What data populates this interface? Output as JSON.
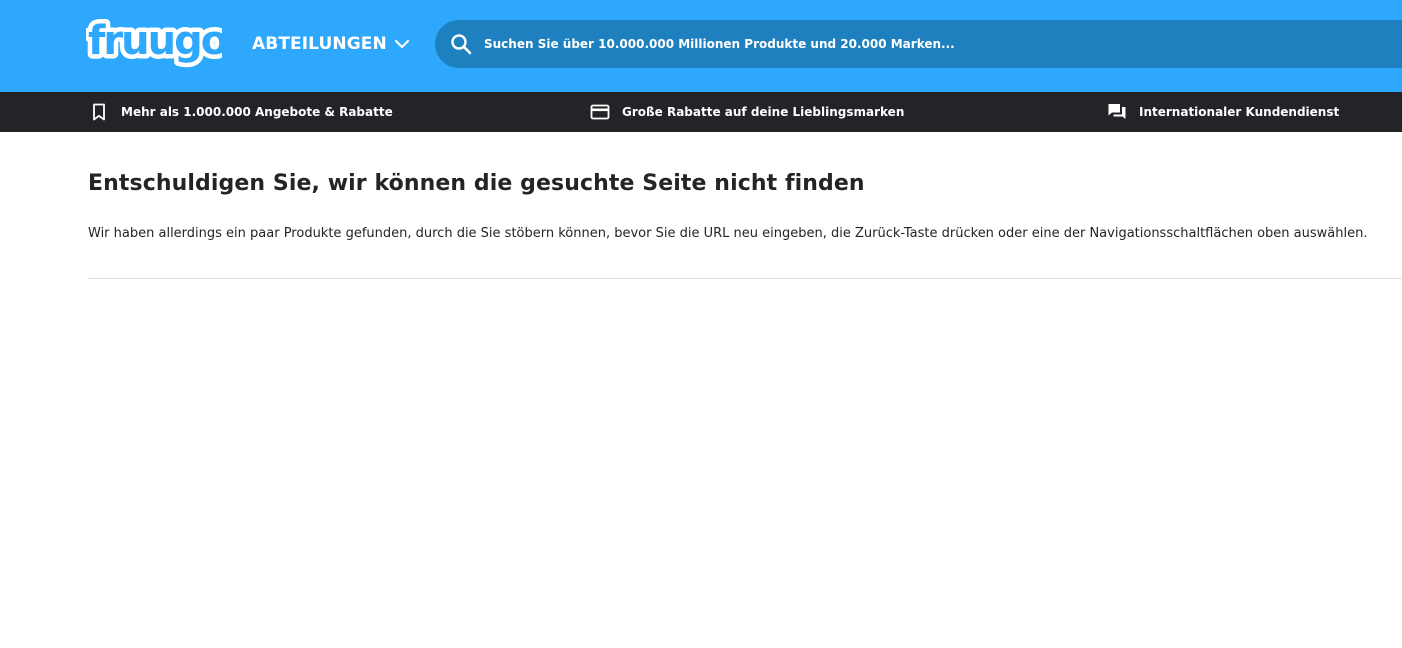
{
  "brand": {
    "logo_text": "fruugo"
  },
  "header": {
    "departments_label": "ABTEILUNGEN",
    "search_placeholder": "Suchen Sie über 10.000.000 Millionen Produkte und 20.000 Marken..."
  },
  "promos": [
    {
      "icon": "bookmark-icon",
      "label": "Mehr als 1.000.000 Angebote & Rabatte"
    },
    {
      "icon": "credit-card-icon",
      "label": "Große Rabatte auf deine Lieblingsmarken"
    },
    {
      "icon": "chat-bubbles-icon",
      "label": "Internationaler Kundendienst"
    }
  ],
  "main": {
    "title": "Entschuldigen Sie, wir können die gesuchte Seite nicht finden",
    "message": "Wir haben allerdings ein paar Produkte gefunden, durch die Sie stöbern können, bevor Sie die URL neu eingeben, die Zurück-Taste drücken oder eine der Navigationsschaltflächen oben auswählen."
  },
  "colors": {
    "header_bg": "#2ea8fc",
    "search_bg": "#1f80bf",
    "promobar_bg": "#222428",
    "text_dark": "#222428",
    "divider": "#dcdcdc"
  }
}
